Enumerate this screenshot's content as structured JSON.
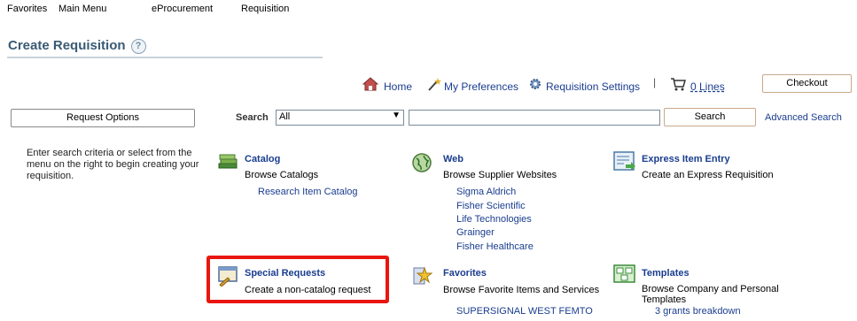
{
  "topnav": {
    "favorites": "Favorites",
    "main_menu": "Main Menu",
    "eprocurement": "eProcurement",
    "requisition": "Requisition"
  },
  "page": {
    "title": "Create Requisition",
    "help_glyph": "?"
  },
  "toolbar": {
    "home": "Home",
    "preferences": "My Preferences",
    "settings": "Requisition Settings",
    "separator": "|",
    "lines": "0 Lines",
    "checkout": "Checkout"
  },
  "search": {
    "request_options": "Request Options",
    "label": "Search",
    "category_value": "All",
    "query_value": "",
    "button": "Search",
    "advanced": "Advanced Search"
  },
  "instructions": "Enter search criteria or select from the menu on the right to begin creating your requisition.",
  "sections": {
    "catalog": {
      "title": "Catalog",
      "subtitle": "Browse Catalogs",
      "links": [
        "Research Item Catalog"
      ]
    },
    "web": {
      "title": "Web",
      "subtitle": "Browse Supplier Websites",
      "links": [
        "Sigma Aldrich",
        "Fisher Scientific",
        "Life Technologies",
        "Grainger",
        "Fisher Healthcare"
      ]
    },
    "express": {
      "title": "Express Item Entry",
      "subtitle": "Create an Express Requisition"
    },
    "special": {
      "title": "Special Requests",
      "subtitle": "Create a non-catalog request"
    },
    "favorites": {
      "title": "Favorites",
      "subtitle": "Browse Favorite Items and Services",
      "links": [
        "SUPERSIGNAL WEST FEMTO"
      ]
    },
    "templates": {
      "title": "Templates",
      "subtitle": "Browse Company and Personal Templates",
      "links": [
        "3 grants breakdown"
      ]
    }
  },
  "colors": {
    "link": "#1a3d8f",
    "title": "#3a5a74",
    "highlight": "#e8160e"
  }
}
